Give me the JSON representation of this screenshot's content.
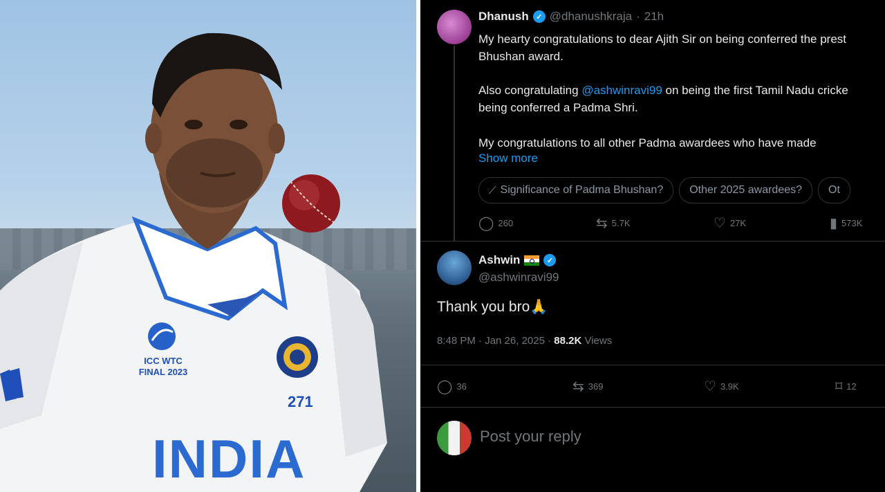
{
  "photo": {
    "badge": {
      "line1": "ICC WTC",
      "line2": "FINAL 2023"
    },
    "jersey_word": "INDIA",
    "jersey_number": "271"
  },
  "tweet": {
    "author_name": "Dhanush",
    "author_handle": "@dhanushkraja",
    "time": "21h",
    "lines": [
      "My hearty congratulations to dear Ajith Sir on being conferred the prest",
      "Bhushan award."
    ],
    "line3_prefix": "Also congratulating ",
    "line3_mention": "@ashwinravi99",
    "line3_suffix": " on being the first Tamil Nadu cricke",
    "line4": "being conferred a Padma Shri.",
    "line5": "My congratulations to all other Padma awardees who have made",
    "show_more": "Show more",
    "chips": [
      "Significance of Padma Bhushan?",
      "Other 2025 awardees?",
      "Ot"
    ],
    "stats": {
      "replies": "260",
      "reposts": "5.7K",
      "likes": "27K",
      "views": "573K"
    }
  },
  "reply": {
    "author_name": "Ashwin",
    "author_handle": "@ashwinravi99",
    "text": "Thank you bro🙏",
    "time": "8:48 PM · Jan 26, 2025 · ",
    "views_count": "88.2K",
    "views_label": " Views",
    "stats": {
      "replies": "36",
      "reposts": "369",
      "likes": "3.9K",
      "bookmarks": "12"
    }
  },
  "composer": {
    "placeholder": "Post your reply"
  },
  "colors": {
    "accent": "#1d9bf0",
    "background": "#000000",
    "muted": "#71767b"
  },
  "icons": [
    "verified-icon",
    "grok-icon",
    "reply-icon",
    "repost-icon",
    "like-icon",
    "views-icon",
    "bookmark-icon",
    "india-flag-icon",
    "prayer-hands-emoji"
  ]
}
